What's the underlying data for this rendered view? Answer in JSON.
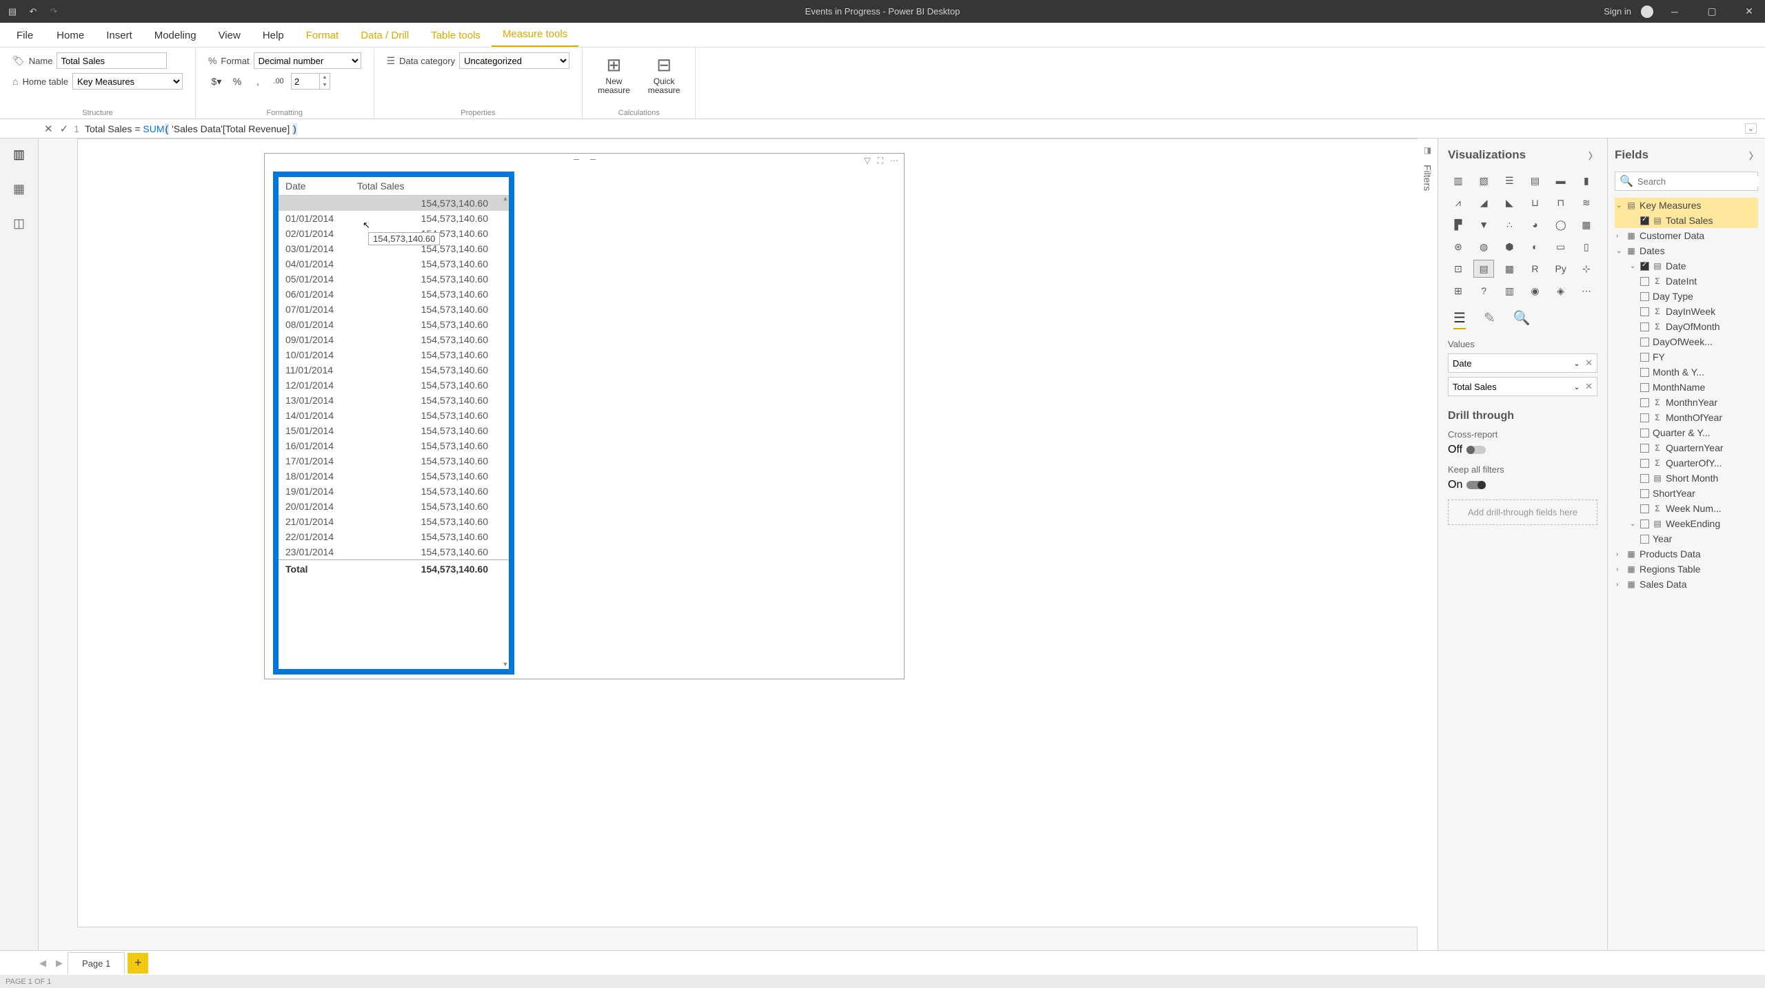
{
  "titlebar": {
    "title": "Events in Progress - Power BI Desktop",
    "signin": "Sign in"
  },
  "menu": {
    "file": "File",
    "home": "Home",
    "insert": "Insert",
    "modeling": "Modeling",
    "view": "View",
    "help": "Help",
    "format": "Format",
    "datadrill": "Data / Drill",
    "tabletools": "Table tools",
    "measuretools": "Measure tools"
  },
  "ribbon": {
    "name_label": "Name",
    "name_value": "Total Sales",
    "home_table_label": "Home table",
    "home_table_value": "Key Measures",
    "structure_label": "Structure",
    "format_label": "Format",
    "format_value": "Decimal number",
    "decimals_value": "2",
    "formatting_label": "Formatting",
    "data_category_label": "Data category",
    "data_category_value": "Uncategorized",
    "properties_label": "Properties",
    "new_measure": "New\nmeasure",
    "quick_measure": "Quick\nmeasure",
    "calculations_label": "Calculations"
  },
  "formula": {
    "line": "1",
    "name": "Total Sales",
    "eq": " = ",
    "fn": "SUM",
    "open": "(",
    "body": " 'Sales Data'[Total Revenue] ",
    "close": ")"
  },
  "table": {
    "headers": {
      "date": "Date",
      "total": "Total Sales"
    },
    "first_total": "154,573,140.60",
    "tooltip": "154,573,140.60",
    "rows": [
      {
        "d": "01/01/2014",
        "v": "154,573,140.60"
      },
      {
        "d": "02/01/2014",
        "v": "154,573,140.60"
      },
      {
        "d": "03/01/2014",
        "v": "154,573,140.60"
      },
      {
        "d": "04/01/2014",
        "v": "154,573,140.60"
      },
      {
        "d": "05/01/2014",
        "v": "154,573,140.60"
      },
      {
        "d": "06/01/2014",
        "v": "154,573,140.60"
      },
      {
        "d": "07/01/2014",
        "v": "154,573,140.60"
      },
      {
        "d": "08/01/2014",
        "v": "154,573,140.60"
      },
      {
        "d": "09/01/2014",
        "v": "154,573,140.60"
      },
      {
        "d": "10/01/2014",
        "v": "154,573,140.60"
      },
      {
        "d": "11/01/2014",
        "v": "154,573,140.60"
      },
      {
        "d": "12/01/2014",
        "v": "154,573,140.60"
      },
      {
        "d": "13/01/2014",
        "v": "154,573,140.60"
      },
      {
        "d": "14/01/2014",
        "v": "154,573,140.60"
      },
      {
        "d": "15/01/2014",
        "v": "154,573,140.60"
      },
      {
        "d": "16/01/2014",
        "v": "154,573,140.60"
      },
      {
        "d": "17/01/2014",
        "v": "154,573,140.60"
      },
      {
        "d": "18/01/2014",
        "v": "154,573,140.60"
      },
      {
        "d": "19/01/2014",
        "v": "154,573,140.60"
      },
      {
        "d": "20/01/2014",
        "v": "154,573,140.60"
      },
      {
        "d": "21/01/2014",
        "v": "154,573,140.60"
      },
      {
        "d": "22/01/2014",
        "v": "154,573,140.60"
      },
      {
        "d": "23/01/2014",
        "v": "154,573,140.60"
      }
    ],
    "total_label": "Total",
    "total_value": "154,573,140.60"
  },
  "filters": {
    "label": "Filters"
  },
  "viz": {
    "title": "Visualizations",
    "values": "Values",
    "field1": "Date",
    "field2": "Total Sales",
    "drill": "Drill through",
    "cross": "Cross-report",
    "off": "Off",
    "keepall": "Keep all filters",
    "on": "On",
    "dropzone": "Add drill-through fields here"
  },
  "fields": {
    "title": "Fields",
    "search": "Search",
    "tables": {
      "key_measures": "Key Measures",
      "total_sales": "Total Sales",
      "customer_data": "Customer Data",
      "dates": "Dates",
      "date": "Date",
      "dateint": "DateInt",
      "daytype": "Day Type",
      "dayinweek": "DayInWeek",
      "dayofmonth": "DayOfMonth",
      "dayofweek": "DayOfWeek...",
      "fy": "FY",
      "monthy": "Month & Y...",
      "monthname": "MonthName",
      "monthnyear": "MonthnYear",
      "monthofyear": "MonthOfYear",
      "quartery": "Quarter & Y...",
      "quarternyear": "QuarternYear",
      "quarterofy": "QuarterOfY...",
      "shortmonth": "Short Month",
      "shortyear": "ShortYear",
      "weeknum": "Week Num...",
      "weekending": "WeekEnding",
      "year": "Year",
      "products_data": "Products Data",
      "regions_table": "Regions Table",
      "sales_data": "Sales Data"
    }
  },
  "pagetabs": {
    "page1": "Page 1"
  },
  "statusbar": {
    "text": "PAGE 1 OF 1"
  }
}
